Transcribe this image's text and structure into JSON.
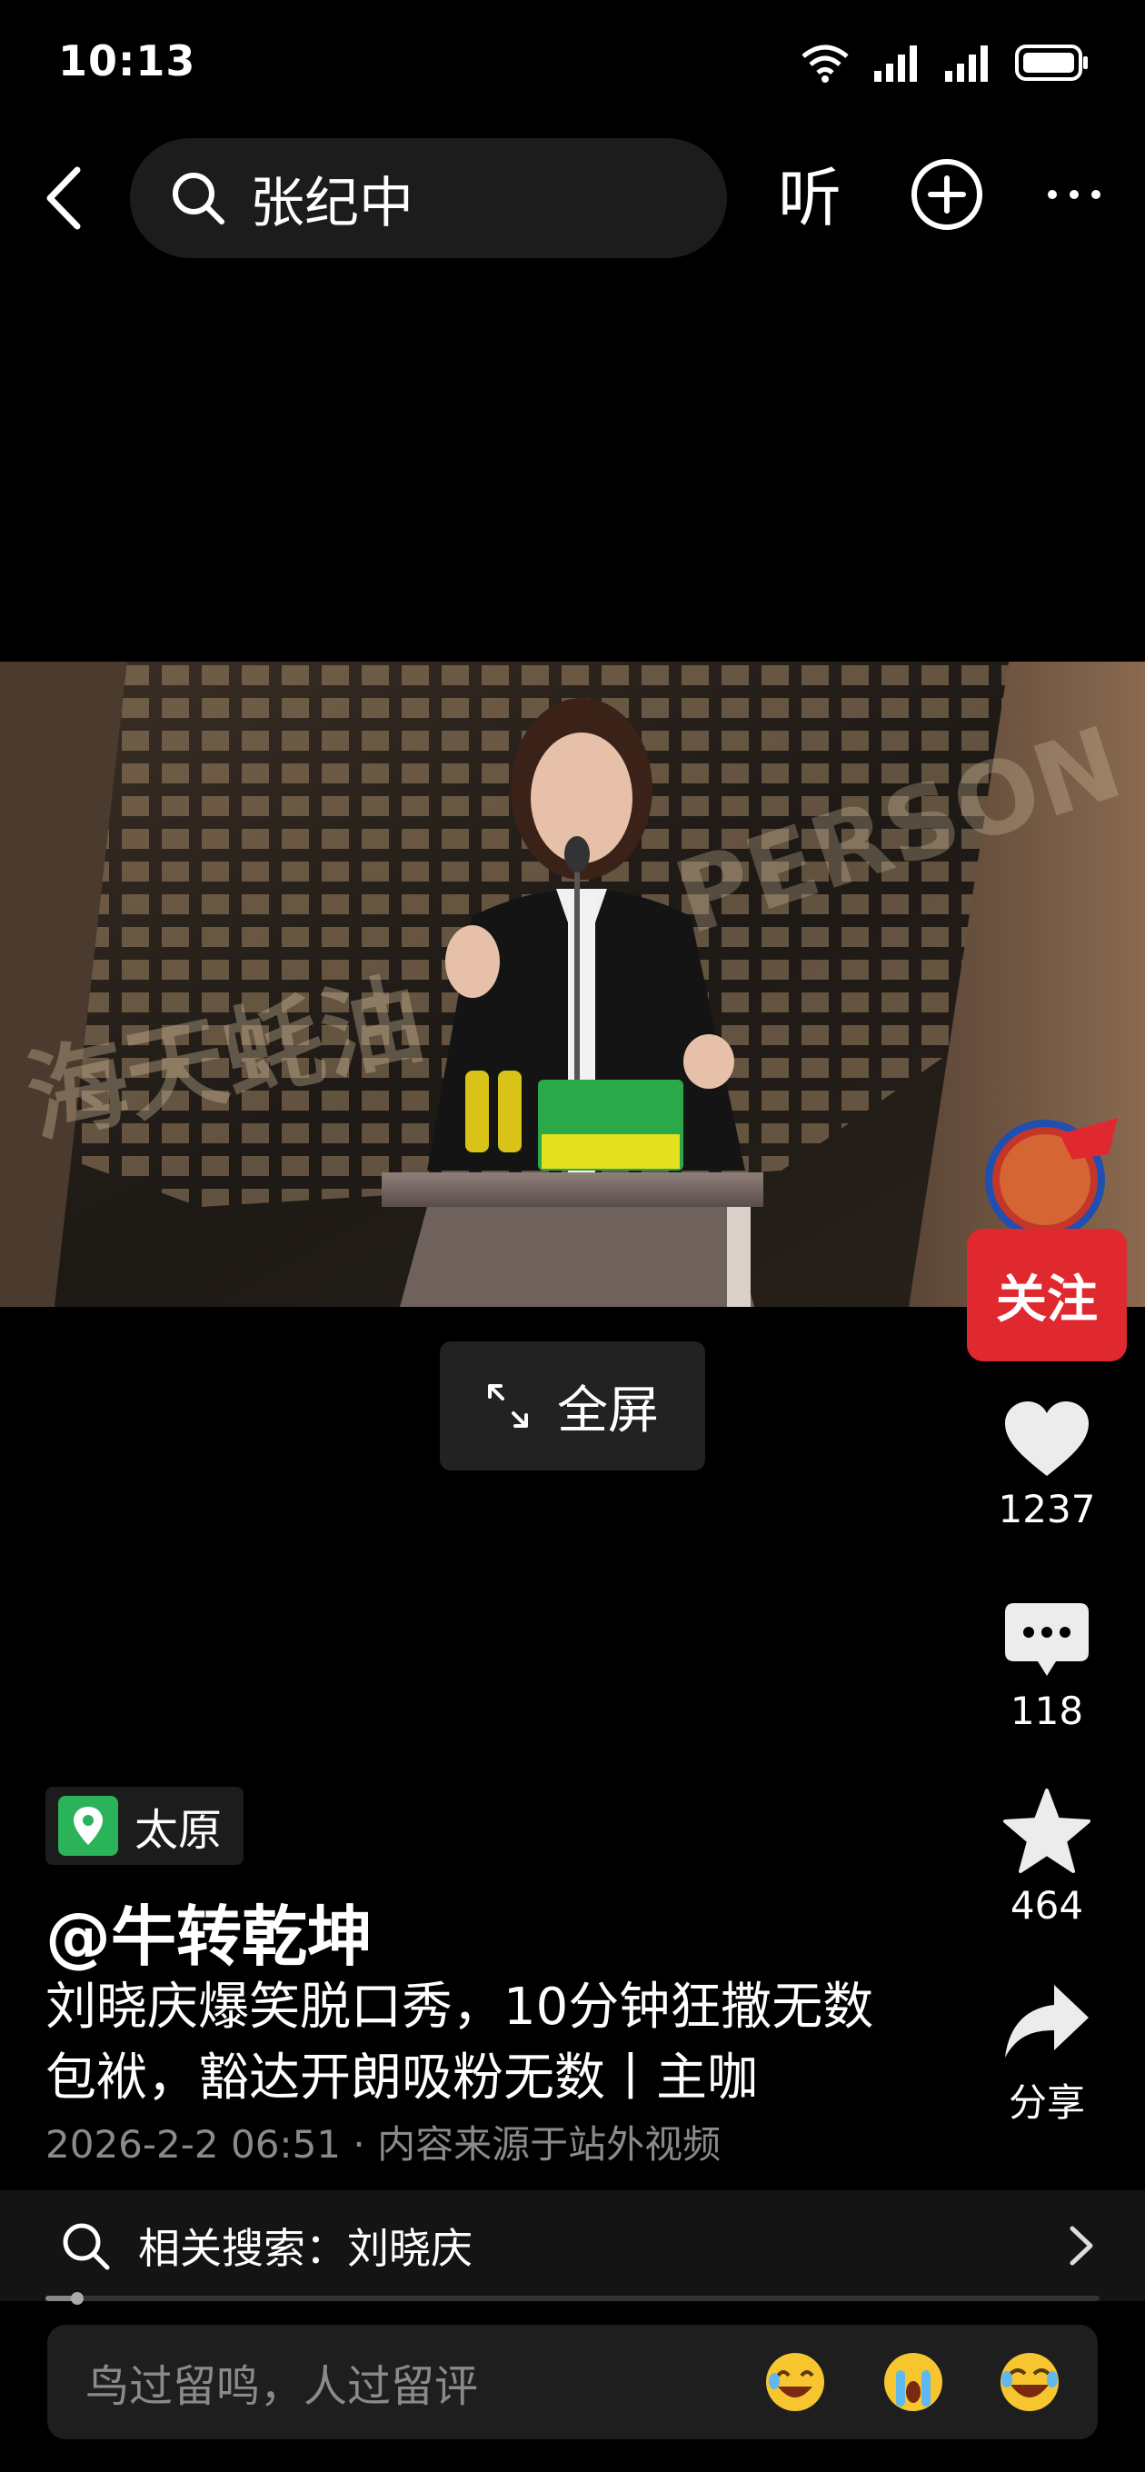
{
  "status": {
    "time": "10:13",
    "icons": [
      "wifi-icon",
      "signal-icon",
      "signal-icon",
      "battery-icon"
    ]
  },
  "top_bar": {
    "search_query": "张纪中",
    "listen_label": "听"
  },
  "video": {
    "fullscreen_label": "全屏",
    "progress": 0.03
  },
  "actions": {
    "follow_label": "关注",
    "like_count": "1237",
    "comment_count": "118",
    "favorite_count": "464",
    "share_label": "分享"
  },
  "post": {
    "location": "太原",
    "author": "@牛转乾坤",
    "description": "刘晓庆爆笑脱口秀，10分钟狂撒无数包袱，豁达开朗吸粉无数丨主咖",
    "meta": "2026-2-2 06:51 · 内容来源于站外视频"
  },
  "related": {
    "label": "相关搜索：刘晓庆"
  },
  "comment": {
    "placeholder": "鸟过留鸣，人过留评",
    "emojis": [
      "laughing-emoji",
      "crying-emoji",
      "rofl-emoji"
    ]
  },
  "colors": {
    "background": "#000000",
    "follow_button": "#e0292e",
    "location_pin": "#2bb35a"
  }
}
